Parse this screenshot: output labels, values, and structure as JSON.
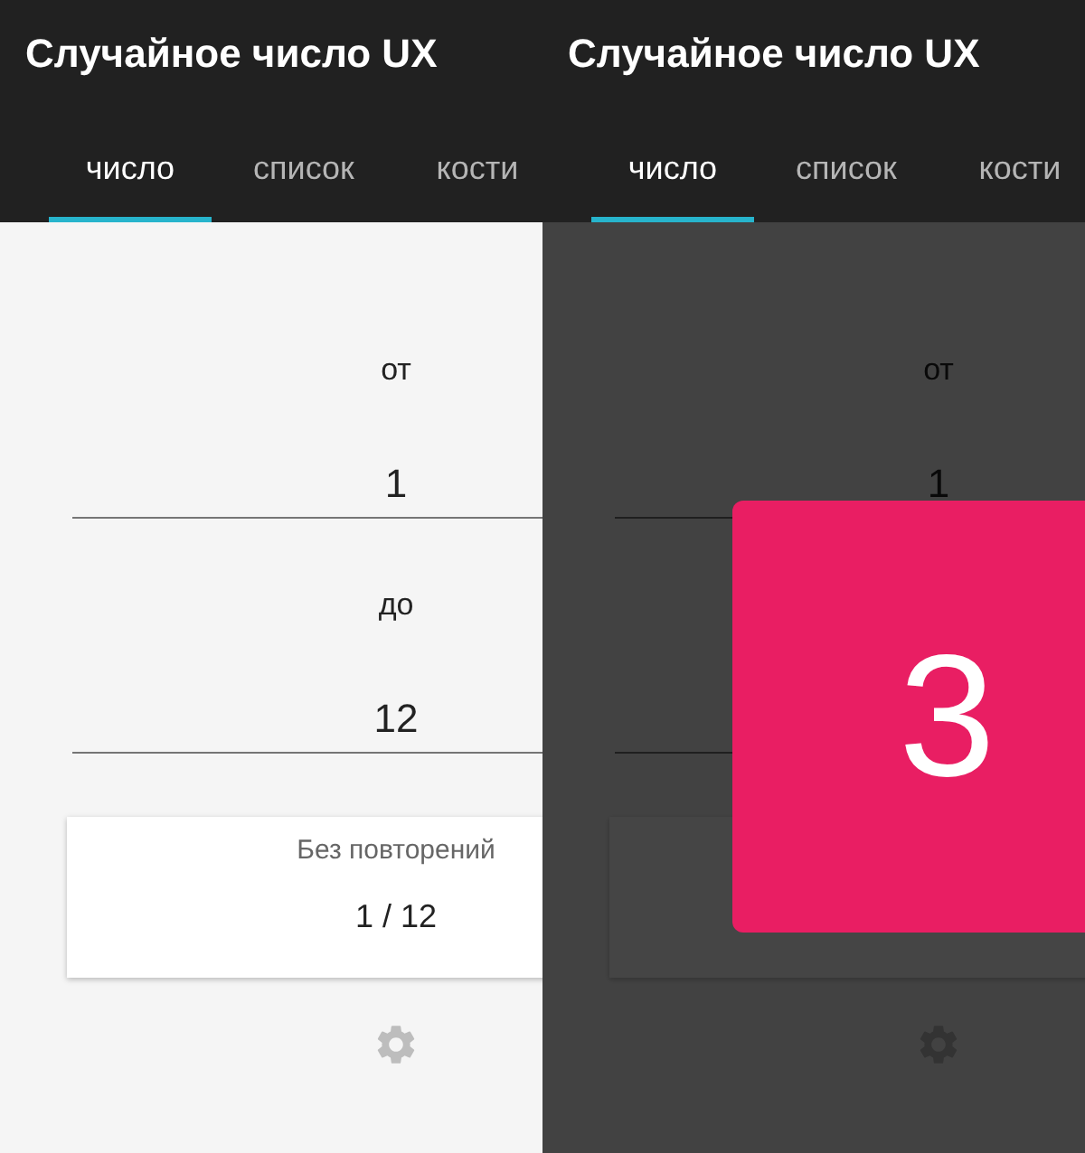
{
  "screens": [
    {
      "title": "Случайное число UX",
      "dimmed": false,
      "tabs": [
        {
          "label": "число",
          "selected": true
        },
        {
          "label": "список",
          "selected": false
        },
        {
          "label": "кости",
          "selected": false
        }
      ],
      "fields": [
        {
          "kind": "input",
          "label": "от",
          "value": "1"
        },
        {
          "kind": "input",
          "label": "до",
          "value": "12"
        }
      ],
      "card": {
        "kind": "counter",
        "label": "Без повторений",
        "value": "1 / 12"
      }
    },
    {
      "title": "Случайное число UX",
      "dimmed": true,
      "tabs": [
        {
          "label": "число",
          "selected": true
        },
        {
          "label": "список",
          "selected": false
        },
        {
          "label": "кости",
          "selected": false
        }
      ],
      "fields": [
        {
          "kind": "input",
          "label": "от",
          "value": "1"
        },
        {
          "kind": "input"
        }
      ],
      "card": {
        "kind": "counter"
      },
      "result": "3"
    }
  ]
}
